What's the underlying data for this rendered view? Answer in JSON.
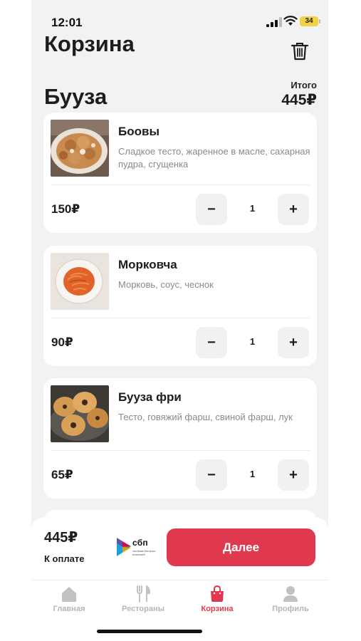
{
  "status_bar": {
    "time": "12:01",
    "battery": "34"
  },
  "header": {
    "title": "Корзина"
  },
  "section": {
    "title": "Бууза",
    "total_label": "Итого",
    "total_value": "445₽"
  },
  "items": [
    {
      "name": "Боовы",
      "description": "Сладкое тесто, жаренное в масле, сахарная пудра, сгущенка",
      "price": "150₽",
      "quantity": "1",
      "minus": "−",
      "plus": "+"
    },
    {
      "name": "Морковча",
      "description": "Морковь, соус, чеснок",
      "price": "90₽",
      "quantity": "1",
      "minus": "−",
      "plus": "+"
    },
    {
      "name": "Бууза фри",
      "description": "Тесто, говяжий фарш, свиной фарш, лук",
      "price": "65₽",
      "quantity": "1",
      "minus": "−",
      "plus": "+"
    }
  ],
  "checkout": {
    "amount": "445₽",
    "amount_label": "К оплате",
    "sbp_logo_text": "сбп",
    "sbp_logo_subtext": "система быстрых платежей",
    "next_label": "Далее"
  },
  "tabs": [
    {
      "label": "Главная",
      "icon": "home-icon",
      "active": false
    },
    {
      "label": "Рестораны",
      "icon": "fork-knife-icon",
      "active": false
    },
    {
      "label": "Корзина",
      "icon": "bag-icon",
      "active": true
    },
    {
      "label": "Профиль",
      "icon": "user-icon",
      "active": false
    }
  ],
  "colors": {
    "accent": "#e0394f",
    "background": "#f2f2f2",
    "card": "#ffffff",
    "muted": "#8a8a8a",
    "inactive_tab": "#b5b5b5"
  }
}
